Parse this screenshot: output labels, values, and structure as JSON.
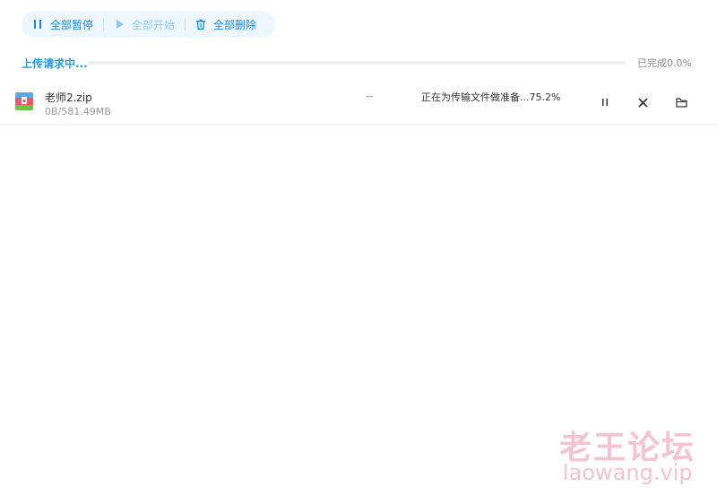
{
  "toolbar": {
    "pause_all_label": "全部暂停",
    "start_all_label": "全部开始",
    "delete_all_label": "全部删除"
  },
  "overall": {
    "status": "上传请求中...",
    "progress_fraction": 0.0,
    "done_text": "已完成0.0%"
  },
  "files": [
    {
      "name": "老师2.zip",
      "size": "0B/581.49MB",
      "speed": "--",
      "progress_text": "正在为传输文件做准备...75.2%",
      "icon": "zip-archive-icon"
    }
  ],
  "watermark": {
    "title": "老王论坛",
    "url": "laowang.vip"
  },
  "colors": {
    "accent": "#1e9be8",
    "toolbar_bg": "#eef7fe",
    "watermark": "#f3c3cf"
  }
}
